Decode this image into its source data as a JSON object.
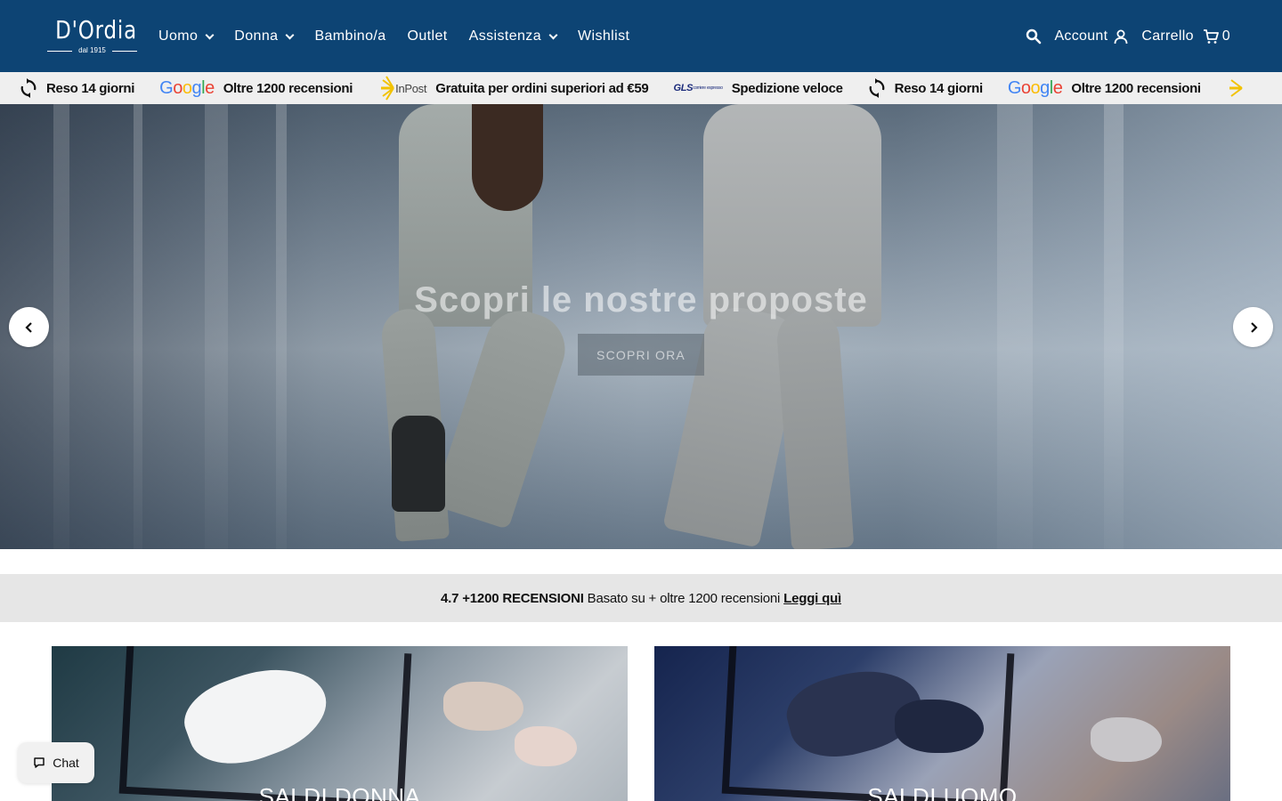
{
  "header": {
    "logo_text": "D'Ordia",
    "logo_subtitle": "dal 1915",
    "nav": [
      {
        "label": "Uomo",
        "has_dropdown": true
      },
      {
        "label": "Donna",
        "has_dropdown": true
      },
      {
        "label": "Bambino/a",
        "has_dropdown": false
      },
      {
        "label": "Outlet",
        "has_dropdown": false
      },
      {
        "label": "Assistenza",
        "has_dropdown": true
      },
      {
        "label": "Wishlist",
        "has_dropdown": false
      }
    ],
    "account_label": "Account",
    "cart_label": "Carrello",
    "cart_count": "0",
    "background_color": "#0d4474"
  },
  "trustbar": {
    "items": [
      {
        "icon": "refresh-icon",
        "text": "Reso 14 giorni"
      },
      {
        "icon": "google-logo",
        "logo_text": "Google",
        "text": "Oltre 1200 recensioni"
      },
      {
        "icon": "inpost-logo",
        "logo_text": "InPost",
        "text": "Gratuita per ordini superiori ad €59"
      },
      {
        "icon": "gls-logo",
        "logo_text": "GLS",
        "logo_subtext": "corriere espresso",
        "text": "Spedizione veloce"
      },
      {
        "icon": "refresh-icon",
        "text": "Reso 14 giorni"
      },
      {
        "icon": "google-logo",
        "logo_text": "Google",
        "text": "Oltre 1200 recensioni"
      }
    ]
  },
  "hero": {
    "title": "Scopri le nostre proposte",
    "button_label": "SCOPRI ORA"
  },
  "reviews": {
    "rating": "4.7 +1200 RECENSIONI",
    "text": "Basato su + oltre 1200 recensioni",
    "link": "Leggi quì"
  },
  "tiles": [
    {
      "title": "SALDI DONNA"
    },
    {
      "title": "SALDI UOMO"
    }
  ],
  "chat": {
    "label": "Chat"
  }
}
